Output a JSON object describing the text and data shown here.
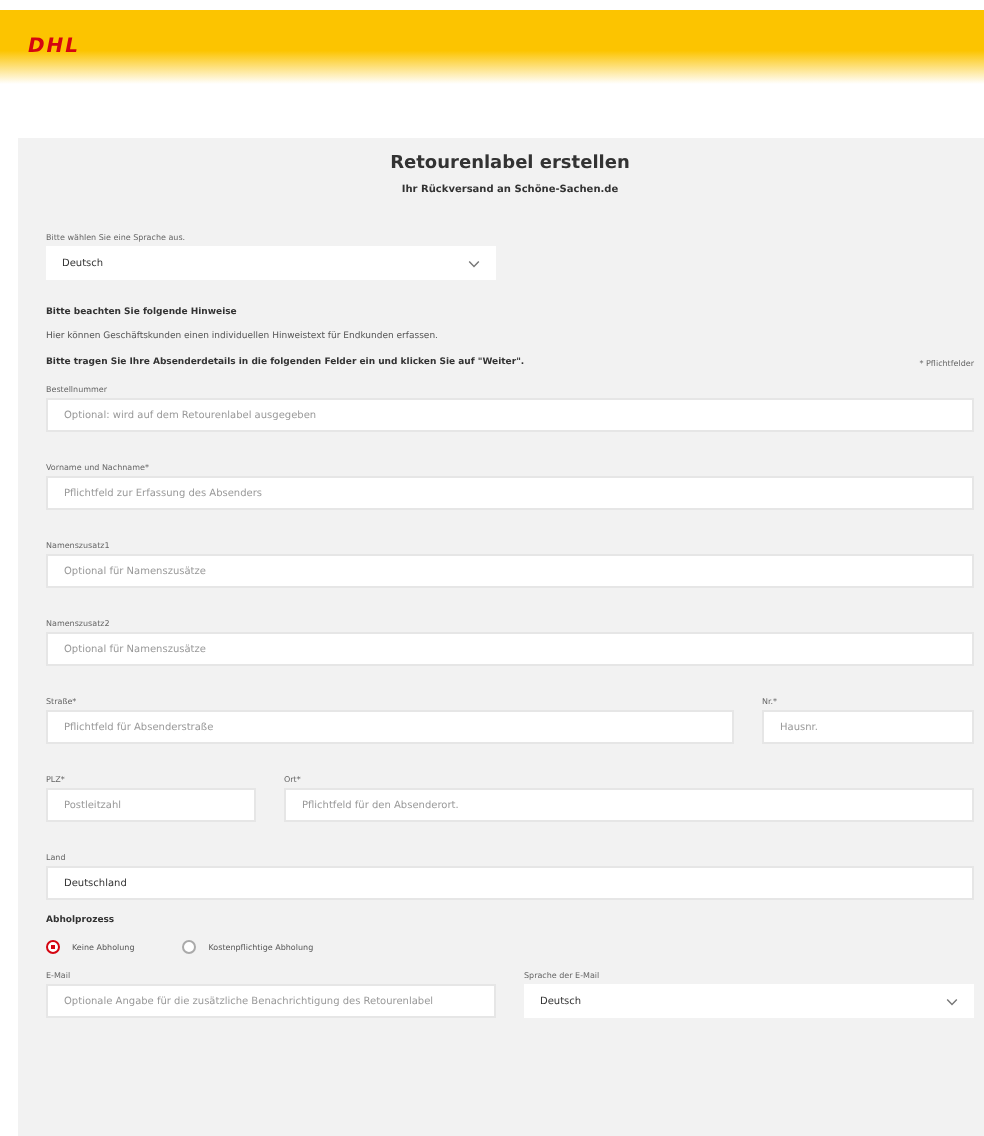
{
  "header": {
    "logo": "DHL"
  },
  "title": "Retourenlabel erstellen",
  "subtitle": "Ihr Rückversand an Schöne-Sachen.de",
  "language": {
    "label": "Bitte wählen Sie eine Sprache aus.",
    "value": "Deutsch"
  },
  "notice": {
    "heading": "Bitte beachten Sie folgende Hinweise",
    "text": "Hier können Geschäftskunden einen individuellen Hinweistext für Endkunden erfassen."
  },
  "instruction": "Bitte tragen Sie Ihre Absenderdetails in die folgenden Felder ein und klicken Sie auf \"Weiter\".",
  "required_note": "* Pflichtfelder",
  "rows": [
    {
      "kind": "full",
      "fields": [
        {
          "kind": "input",
          "label": "Bestellnummer",
          "placeholder": "Optional: wird auf dem Retourenlabel ausgegeben"
        }
      ]
    },
    {
      "kind": "full",
      "fields": [
        {
          "kind": "input",
          "label": "Vorname und Nachname*",
          "placeholder": "Pflichtfeld zur Erfassung des Absenders"
        }
      ]
    },
    {
      "kind": "full",
      "fields": [
        {
          "kind": "input",
          "label": "Namenszusatz1",
          "placeholder": "Optional für Namenszusätze"
        }
      ]
    },
    {
      "kind": "full",
      "fields": [
        {
          "kind": "input",
          "label": "Namenszusatz2",
          "placeholder": "Optional für Namenszusätze"
        }
      ]
    },
    {
      "kind": "street",
      "fields": [
        {
          "kind": "input",
          "label": "Straße*",
          "placeholder": "Pflichtfeld für Absenderstraße"
        },
        {
          "kind": "input",
          "label": "Nr.*",
          "placeholder": "Hausnr."
        }
      ]
    },
    {
      "kind": "city",
      "fields": [
        {
          "kind": "input",
          "label": "PLZ*",
          "placeholder": "Postleitzahl"
        },
        {
          "kind": "input",
          "label": "Ort*",
          "placeholder": "Pflichtfeld für den Absenderort."
        }
      ]
    },
    {
      "kind": "full",
      "fields": [
        {
          "kind": "input",
          "label": "Land",
          "value": "Deutschland"
        }
      ]
    }
  ],
  "pickup": {
    "heading": "Abholprozess",
    "options": [
      {
        "label": "Keine Abholung",
        "selected": true
      },
      {
        "label": "Kostenpflichtige Abholung",
        "selected": false
      }
    ]
  },
  "email_row": {
    "kind": "pair",
    "fields": [
      {
        "kind": "input",
        "label": "E-Mail",
        "placeholder": "Optionale Angabe für die zusätzliche Benachrichtigung des Retourenlabel"
      },
      {
        "kind": "select",
        "label": "Sprache der E-Mail",
        "value": "Deutsch"
      }
    ]
  }
}
